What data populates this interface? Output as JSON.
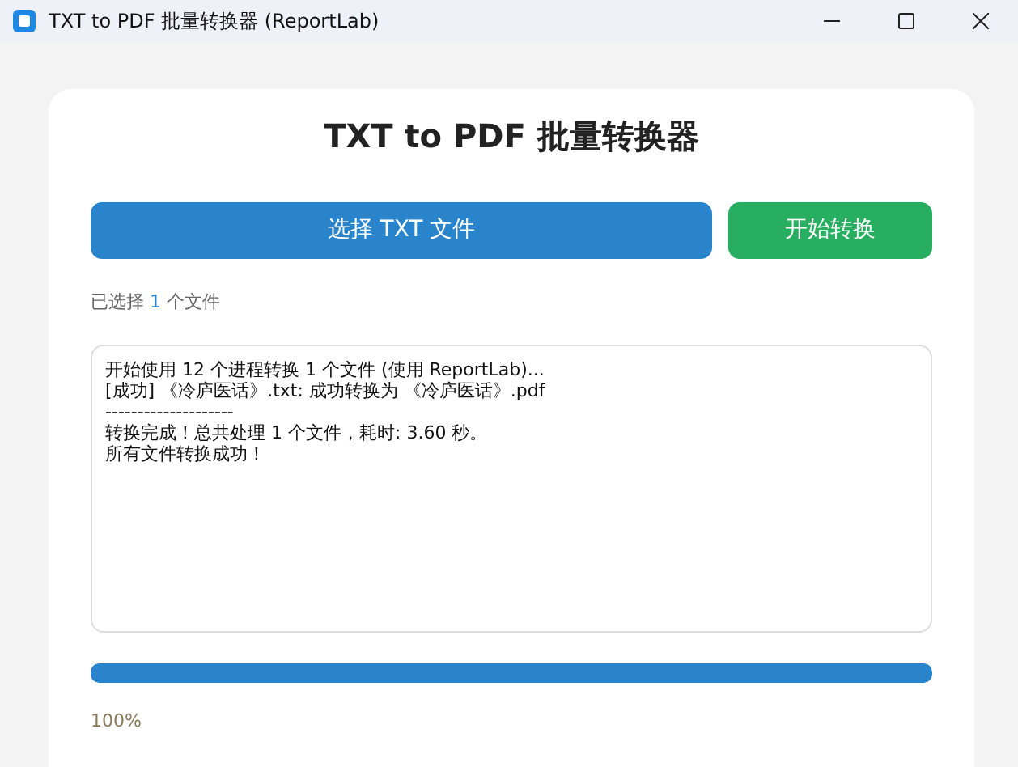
{
  "window": {
    "title": "TXT to PDF 批量转换器 (ReportLab)"
  },
  "heading": "TXT to PDF 批量转换器",
  "buttons": [
    {
      "kind": "primary",
      "label": "选择 TXT 文件"
    },
    {
      "kind": "success",
      "label": "开始转换"
    }
  ],
  "selection": {
    "prefix": "已选择",
    "count": "1",
    "suffix": "个文件"
  },
  "log": [
    "开始使用 12 个进程转换 1 个文件 (使用 ReportLab)...",
    "[成功] 《冷庐医话》.txt: 成功转换为 《冷庐医话》.pdf",
    "--------------------",
    "转换完成！总共处理 1 个文件，耗时: 3.60 秒。",
    "所有文件转换成功！"
  ],
  "progress": {
    "level": 1,
    "reading": "100%"
  }
}
